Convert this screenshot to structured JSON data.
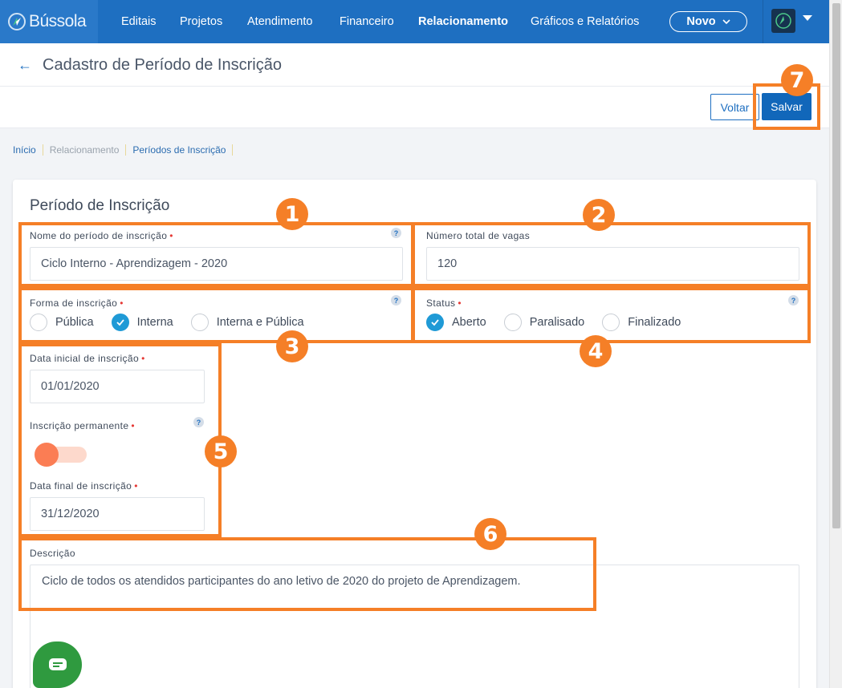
{
  "app": {
    "brand": "Bússola",
    "nav": [
      "Editais",
      "Projetos",
      "Atendimento",
      "Financeiro",
      "Relacionamento",
      "Gráficos e Relatórios"
    ],
    "active_nav": "Relacionamento",
    "novo_label": "Novo"
  },
  "page": {
    "title": "Cadastro de Período de Inscrição",
    "voltar_label": "Voltar",
    "salvar_label": "Salvar"
  },
  "breadcrumb": [
    "Início",
    "Relacionamento",
    "Períodos de Inscrição"
  ],
  "form": {
    "card_title": "Período de Inscrição",
    "nome": {
      "label": "Nome do período de inscrição",
      "value": "Ciclo Interno - Aprendizagem - 2020"
    },
    "vagas": {
      "label": "Número total de vagas",
      "value": "120"
    },
    "forma": {
      "label": "Forma de inscrição",
      "options": [
        "Pública",
        "Interna",
        "Interna e Pública"
      ],
      "selected": "Interna"
    },
    "status": {
      "label": "Status",
      "options": [
        "Aberto",
        "Paralisado",
        "Finalizado"
      ],
      "selected": "Aberto"
    },
    "data_inicial": {
      "label": "Data inicial de inscrição",
      "value": "01/01/2020"
    },
    "permanente": {
      "label": "Inscrição permanente"
    },
    "data_final": {
      "label": "Data final de inscrição",
      "value": "31/12/2020"
    },
    "descricao": {
      "label": "Descrição",
      "value": "Ciclo de todos os atendidos participantes do ano letivo de 2020 do projeto de Aprendizagem."
    }
  },
  "annotations": [
    "1",
    "2",
    "3",
    "4",
    "5",
    "6",
    "7"
  ],
  "colors": {
    "nav": "#1e6fc1",
    "accent": "#1f9ad6",
    "annotation": "#f57f27",
    "toggle": "#fb7d54"
  }
}
